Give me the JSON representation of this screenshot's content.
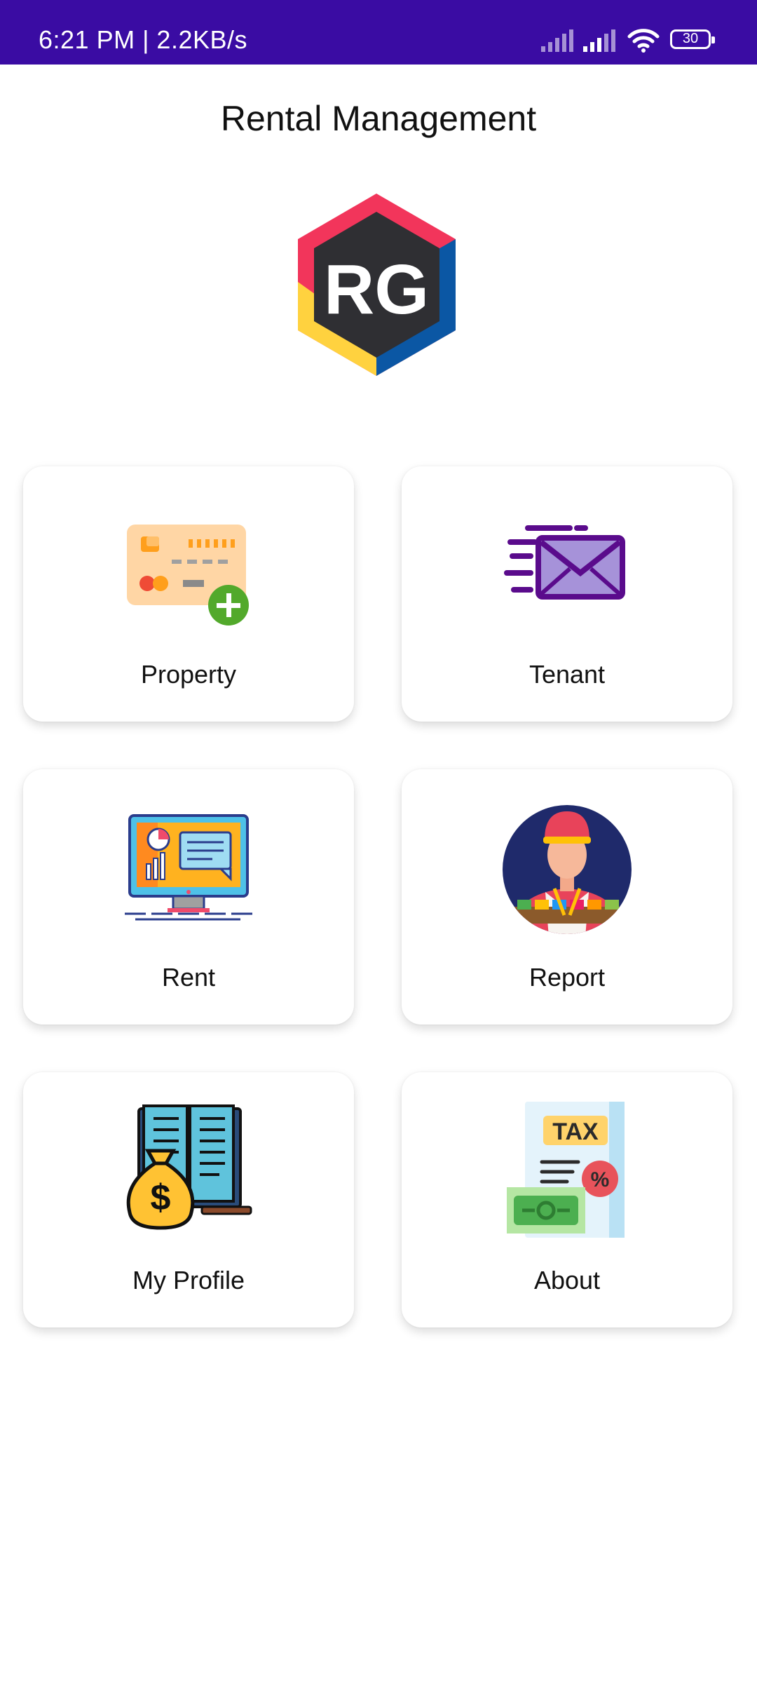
{
  "status_bar": {
    "time_speed": "6:21 PM | 2.2KB/s",
    "battery": "30",
    "icons": [
      "signal-icon",
      "signal-icon",
      "wifi-icon",
      "battery-icon"
    ]
  },
  "app": {
    "title": "Rental Management",
    "logo_text": "RG"
  },
  "menu": [
    {
      "label": "Property",
      "icon": "credit-card-add-icon"
    },
    {
      "label": "Tenant",
      "icon": "envelope-icon"
    },
    {
      "label": "Rent",
      "icon": "monitor-chart-icon"
    },
    {
      "label": "Report",
      "icon": "vendor-person-icon"
    },
    {
      "label": "My Profile",
      "icon": "money-bag-book-icon"
    },
    {
      "label": "About",
      "icon": "tax-document-icon"
    }
  ],
  "colors": {
    "status_bar": "#3a0ca3",
    "background": "#ffffff"
  }
}
